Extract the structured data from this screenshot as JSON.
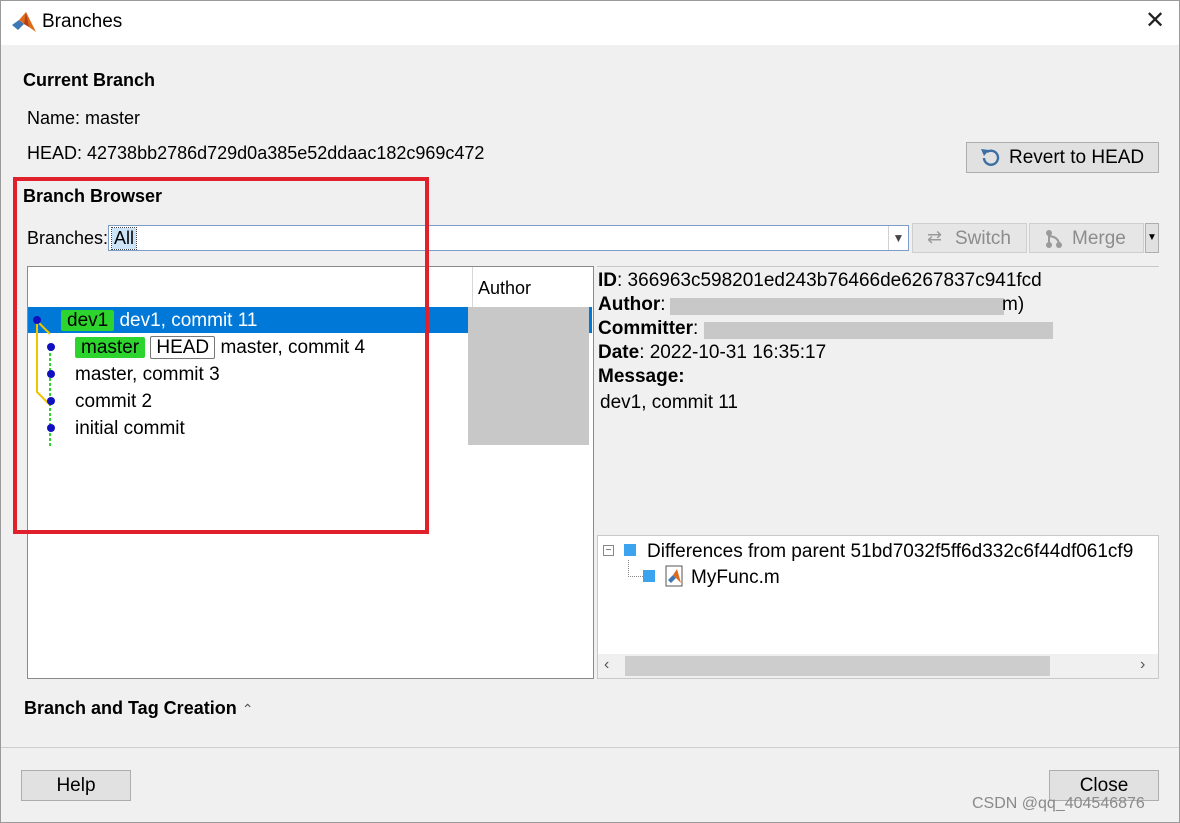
{
  "window": {
    "title": "Branches",
    "icon": "matlab-logo-icon",
    "close_icon": "close-icon"
  },
  "current_branch": {
    "heading": "Current Branch",
    "name": "Name: master",
    "head": "HEAD: 42738bb2786d729d0a385e52ddaac182c969c472",
    "revert_button": "Revert to HEAD"
  },
  "branch_browser": {
    "heading": "Branch Browser",
    "branches_label": "Branches:",
    "branches_value": "All",
    "switch_button": "Switch",
    "merge_button": "Merge",
    "author_column": "Author",
    "commits": [
      {
        "tags": [
          "dev1"
        ],
        "message": "dev1, commit 11",
        "selected": true
      },
      {
        "tags": [
          "master",
          "HEAD"
        ],
        "message": "master, commit 4",
        "selected": false
      },
      {
        "tags": [],
        "message": "master, commit 3",
        "selected": false
      },
      {
        "tags": [],
        "message": "commit 2",
        "selected": false
      },
      {
        "tags": [],
        "message": "initial commit",
        "selected": false
      }
    ]
  },
  "details": {
    "id_label": "ID",
    "id_value": ": 366963c598201ed243b76466de6267837c941fcd",
    "author_label": "Author",
    "author_value": ":",
    "author_suffix": "m)",
    "committer_label": "Committer",
    "committer_value": ":",
    "date_label": "Date",
    "date_value": ": 2022-10-31 16:35:17",
    "message_label": "Message:",
    "message_value": "dev1, commit 11"
  },
  "differences": {
    "root": "Differences from parent 51bd7032f5ff6d332c6f44df061cf9",
    "file": "MyFunc.m"
  },
  "tag_creation": {
    "heading": "Branch and Tag Creation"
  },
  "footer": {
    "help_button": "Help",
    "close_button": "Close"
  },
  "watermark": "CSDN @qq_404546876",
  "colors": {
    "selection": "#0078d7",
    "tag_green": "#2dd42d",
    "highlight_box": "#e0202a"
  }
}
